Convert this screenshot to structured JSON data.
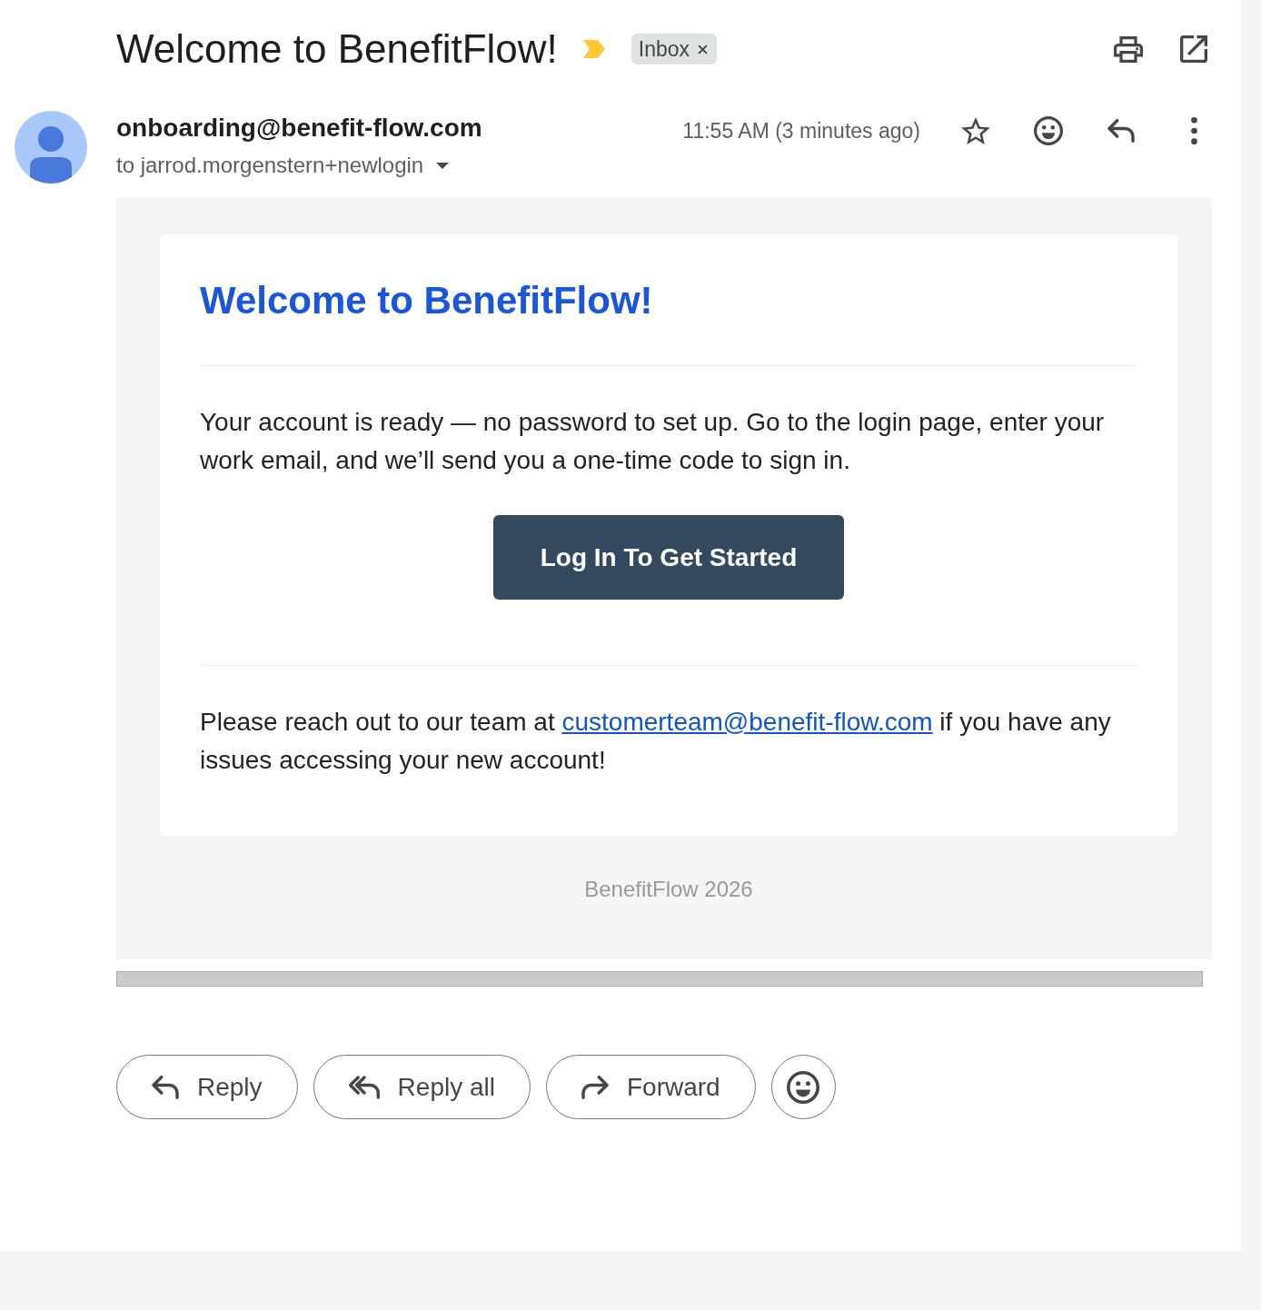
{
  "subject_bar": {
    "subject": "Welcome to BenefitFlow!",
    "important": true,
    "labels": [
      {
        "text": "Inbox"
      }
    ]
  },
  "sender": {
    "email": "onboarding@benefit-flow.com",
    "recipient": "to jarrod.morgenstern+newlogin",
    "time": "11:55 AM (3 minutes ago)",
    "starred": false
  },
  "message": {
    "heading": "Welcome to BenefitFlow!",
    "intro": "Your account is ready — no password to set up. Go to the login page, enter your work email, and we’ll send you a one-time code to sign in.",
    "button": "Log In To Get Started",
    "contact": {
      "before": "Please reach out to our team at ",
      "link": "customerteam@benefit-flow.com",
      "after": " if you have any issues accessing your new account!"
    },
    "footer": "BenefitFlow 2026"
  },
  "actions": [
    {
      "kind": "reply",
      "label": "Reply"
    },
    {
      "kind": "reply_all",
      "label": "Reply all"
    },
    {
      "kind": "forward",
      "label": "Forward"
    },
    {
      "kind": "react"
    }
  ]
}
